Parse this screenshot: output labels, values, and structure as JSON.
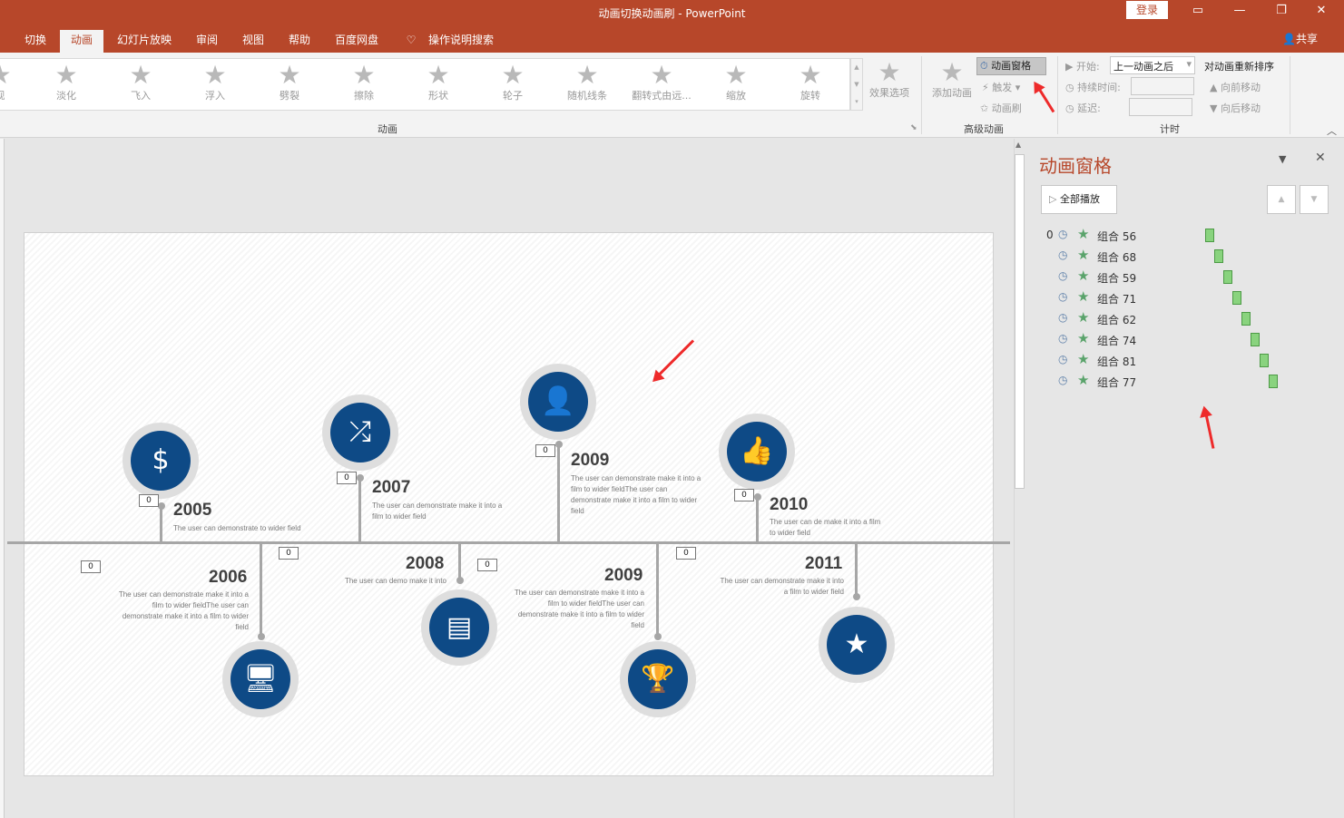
{
  "title": "动画切换动画刷  -  PowerPoint",
  "login": "登录",
  "share": "共享",
  "tabs": [
    {
      "label": "切换"
    },
    {
      "label": "动画"
    },
    {
      "label": "幻灯片放映"
    },
    {
      "label": "审阅"
    },
    {
      "label": "视图"
    },
    {
      "label": "帮助"
    },
    {
      "label": "百度网盘"
    },
    {
      "label": "操作说明搜索"
    }
  ],
  "gallery": [
    {
      "label": "现"
    },
    {
      "label": "淡化"
    },
    {
      "label": "飞入"
    },
    {
      "label": "浮入"
    },
    {
      "label": "劈裂"
    },
    {
      "label": "擦除"
    },
    {
      "label": "形状"
    },
    {
      "label": "轮子"
    },
    {
      "label": "随机线条"
    },
    {
      "label": "翻转式由远..."
    },
    {
      "label": "缩放"
    },
    {
      "label": "旋转"
    }
  ],
  "groups": {
    "animation": "动画",
    "advanced": "高级动画",
    "timing": "计时"
  },
  "ribbon": {
    "effect_options": "效果选项",
    "add_animation": "添加动画",
    "animation_pane": "动画窗格",
    "trigger": "触发",
    "painter": "动画刷",
    "start_label": "开始:",
    "start_value": "上一动画之后",
    "duration_label": "持续时间:",
    "delay_label": "延迟:",
    "reorder": "对动画重新排序",
    "move_earlier": "向前移动",
    "move_later": "向后移动"
  },
  "pane": {
    "title": "动画窗格",
    "play_all": "全部播放",
    "first_index": "0",
    "items": [
      {
        "name": "组合 56"
      },
      {
        "name": "组合 68"
      },
      {
        "name": "组合 59"
      },
      {
        "name": "组合 71"
      },
      {
        "name": "组合 62"
      },
      {
        "name": "组合 74"
      },
      {
        "name": "组合 81"
      },
      {
        "name": "组合 77"
      }
    ]
  },
  "slide": {
    "tag_value": "0",
    "events": [
      {
        "year": "2005",
        "desc": "The user can demonstrate to wider field",
        "icon": "money-icon"
      },
      {
        "year": "2006",
        "desc": "The user can demonstrate make it into a film to wider fieldThe user can demonstrate make it into a film to wider field",
        "icon": "monitor-lock-icon"
      },
      {
        "year": "2007",
        "desc": "The user can demonstrate make it into a film to wider field",
        "icon": "shuffle-icon"
      },
      {
        "year": "2008",
        "desc": "The user can demo make it into",
        "icon": "certificate-icon"
      },
      {
        "year": "2009",
        "desc": "The user can demonstrate make it into a film to wider fieldThe user can demonstrate make it into a film to wider field",
        "icon": "person-icon"
      },
      {
        "year": "2009",
        "desc": "The user can demonstrate make it into a film to wider fieldThe user can demonstrate make it into a film to wider field",
        "icon": "trophy-icon"
      },
      {
        "year": "2010",
        "desc": "The user can de make it into a film to wider field",
        "icon": "thumbs-up-icon"
      },
      {
        "year": "2011",
        "desc": "The user can demonstrate make it into a film to wider field",
        "icon": "star-icon"
      }
    ]
  },
  "colors": {
    "accent": "#b7472a",
    "icon_bg": "#0e4a86",
    "bar_fill": "#89d37e",
    "arrow": "#ee2a2a"
  }
}
